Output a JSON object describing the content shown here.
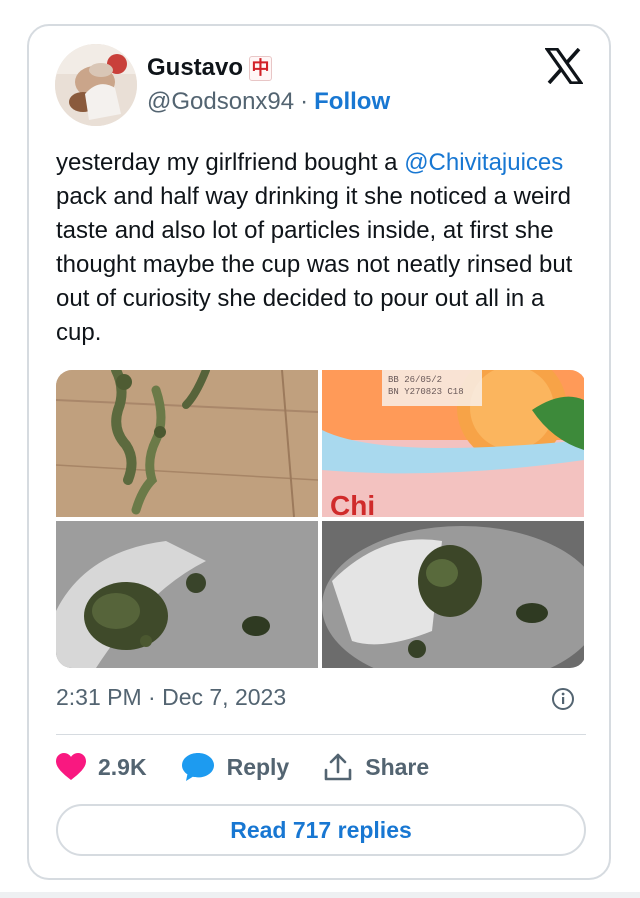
{
  "author": {
    "name": "Gustavo",
    "name_emoji": "中",
    "handle": "@Godsonx94",
    "separator": "·",
    "follow_label": "Follow"
  },
  "platform_logo": "x-logo",
  "tweet": {
    "text_before": "yesterday my girlfriend bought a ",
    "mention": "@Chivitajuices",
    "text_after": " pack and half way drinking it she noticed a weird taste and also lot of particles  inside, at first she thought maybe the cup was not neatly rinsed but out of curiosity she decided to pour out all in a cup.",
    "carton_print": {
      "bb": "BB  26/05/2",
      "bn": "BN  Y270823 C18",
      "brand": "Chi"
    },
    "timestamp": "2:31 PM · Dec 7, 2023"
  },
  "actions": {
    "like_count": "2.9K",
    "reply_label": "Reply",
    "share_label": "Share"
  },
  "read_replies_label": "Read 717 replies",
  "colors": {
    "link": "#1877d2",
    "text": "#0f1419",
    "secondary": "#536471",
    "heart": "#f91880",
    "border": "#d6dbe0"
  },
  "icons": [
    "info-icon",
    "heart-icon",
    "reply-bubble-icon",
    "share-icon"
  ]
}
